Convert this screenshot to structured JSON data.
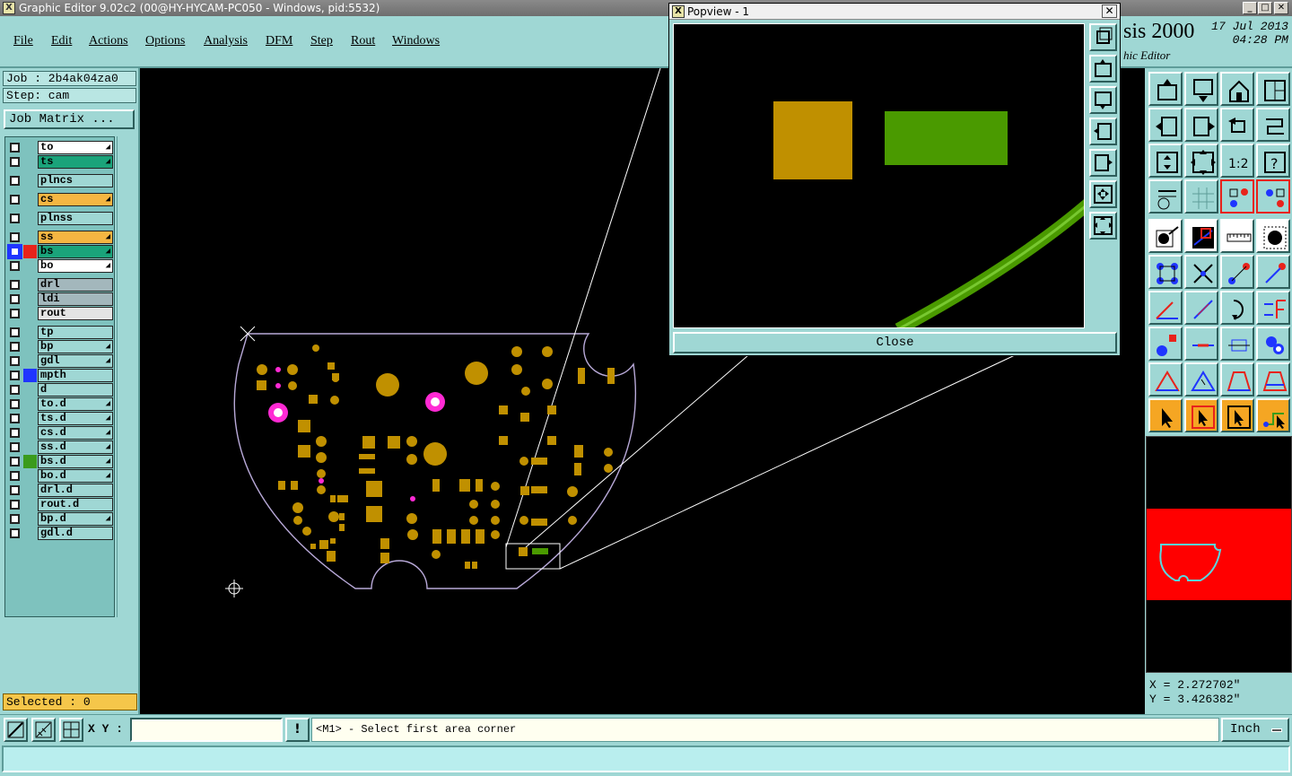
{
  "window": {
    "title": "Graphic Editor 9.02c2 (00@HY-HYCAM-PC050 - Windows, pid:5532)",
    "icon": "x-window-icon"
  },
  "menu": [
    "File",
    "Edit",
    "Actions",
    "Options",
    "Analysis",
    "DFM",
    "Step",
    "Rout",
    "Windows"
  ],
  "brand": {
    "title": "sis 2000",
    "subtitle": "hic Editor",
    "date": "17 Jul 2013",
    "time": "04:28 PM"
  },
  "job": {
    "job_line": "Job : 2b4ak04za0",
    "step_line": "Step: cam",
    "matrix_label": "Job Matrix ..."
  },
  "layers": [
    {
      "name": "to",
      "color": "#ffffff",
      "edit": true
    },
    {
      "name": "ts",
      "color": "#1aa37a",
      "edit": true
    },
    {
      "name": "plncs",
      "color": "#9fd7d4",
      "edit": false
    },
    {
      "name": "cs",
      "color": "#f5b642",
      "edit": true
    },
    {
      "name": "plnss",
      "color": "#9fd7d4",
      "edit": false
    },
    {
      "name": "ss",
      "color": "#f5b642",
      "edit": true
    },
    {
      "name": "bs",
      "color": "#1aa37a",
      "edit": true,
      "swatch": "#e8231b",
      "active": true
    },
    {
      "name": "bo",
      "color": "#ffffff",
      "edit": true
    },
    {
      "name": "drl",
      "color": "#a3b7bc",
      "edit": false
    },
    {
      "name": "ldi",
      "color": "#a3b7bc",
      "edit": false
    },
    {
      "name": "rout",
      "color": "#e4e4e4",
      "edit": false
    },
    {
      "name": "tp",
      "color": "#9fd7d4",
      "edit": false
    },
    {
      "name": "bp",
      "color": "#9fd7d4",
      "edit": true
    },
    {
      "name": "gdl",
      "color": "#9fd7d4",
      "edit": true
    },
    {
      "name": "mpth",
      "color": "#9fd7d4",
      "edit": false,
      "swatch": "#1f35ff"
    },
    {
      "name": "d",
      "color": "#9fd7d4",
      "edit": false
    },
    {
      "name": "to.d",
      "color": "#9fd7d4",
      "edit": true
    },
    {
      "name": "ts.d",
      "color": "#9fd7d4",
      "edit": true
    },
    {
      "name": "cs.d",
      "color": "#9fd7d4",
      "edit": true
    },
    {
      "name": "ss.d",
      "color": "#9fd7d4",
      "edit": true
    },
    {
      "name": "bs.d",
      "color": "#9fd7d4",
      "edit": true,
      "swatch": "#3a9b1c"
    },
    {
      "name": "bo.d",
      "color": "#9fd7d4",
      "edit": true
    },
    {
      "name": "drl.d",
      "color": "#9fd7d4",
      "edit": false
    },
    {
      "name": "rout.d",
      "color": "#9fd7d4",
      "edit": false
    },
    {
      "name": "bp.d",
      "color": "#9fd7d4",
      "edit": true
    },
    {
      "name": "gdl.d",
      "color": "#9fd7d4",
      "edit": false
    }
  ],
  "selected": "Selected : 0",
  "popview": {
    "title": "Popview - 1",
    "close_label": "Close",
    "close_icon": "close-x-icon"
  },
  "coords": {
    "x_line": "X = 2.272702\"",
    "y_line": "Y = 3.426382\""
  },
  "statusbar": {
    "xy_label": "X Y :",
    "xy_value": "",
    "prompt": "<M1> - Select first area corner",
    "unit": "Inch",
    "alert_icon": "!"
  },
  "colors": {
    "panel": "#9fd7d4",
    "pad": "#c09000",
    "magenta": "#ff2ad4",
    "green": "#4a9a00",
    "overview_red": "#ff0000"
  }
}
